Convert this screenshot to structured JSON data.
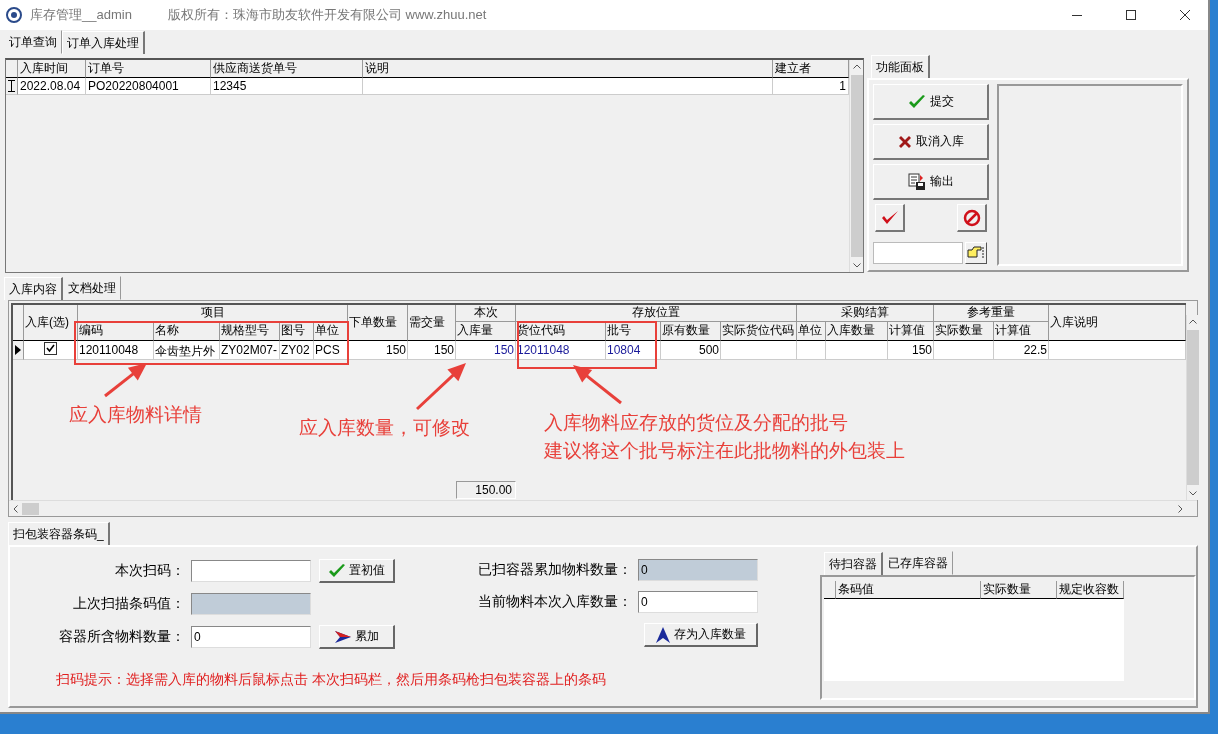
{
  "window": {
    "title": "库存管理__admin",
    "copyright": "版权所有：珠海市助友软件开发有限公司 www.zhuu.net"
  },
  "main_tabs": [
    {
      "label": "订单查询",
      "selected": false
    },
    {
      "label": "订单入库处理",
      "selected": true
    }
  ],
  "order_grid": {
    "columns": [
      "入库时间",
      "订单号",
      "供应商送货单号",
      "说明",
      "建立者"
    ],
    "rows": [
      {
        "editing": true,
        "cells": [
          "2022.08.04",
          "PO20220804001",
          "12345",
          null,
          "1"
        ]
      }
    ]
  },
  "function_panel": {
    "tab": {
      "label": "功能面板",
      "selected": true
    },
    "buttons": [
      {
        "kind": "check",
        "label": "提交"
      },
      {
        "kind": "cross",
        "label": "取消入库"
      },
      {
        "kind": "export",
        "label": "输出"
      }
    ],
    "small_buttons": [
      {
        "kind": "redcheck"
      },
      {
        "kind": "prohibit"
      }
    ],
    "field_button": {
      "kind": "hand"
    }
  },
  "detail_tabs": [
    {
      "label": "入库内容",
      "selected": true
    },
    {
      "label": "文档处理",
      "selected": false
    }
  ],
  "detail_grid": {
    "header": [
      {
        "label": "入库(选)",
        "kind": "check"
      },
      {
        "label": "项目",
        "children": [
          {
            "label": "编码",
            "kind": "text",
            "highlighted": false
          },
          {
            "label": "名称",
            "kind": "text",
            "highlighted": false
          },
          {
            "label": "规格型号",
            "kind": "text",
            "highlighted": false
          },
          {
            "label": "图号",
            "kind": "text",
            "highlighted": false
          },
          {
            "label": "单位",
            "kind": "text",
            "highlighted": false
          }
        ]
      },
      {
        "label": "下单数量",
        "kind": "number",
        "highlighted": false
      },
      {
        "label": "需交量",
        "kind": "number",
        "highlighted": false
      },
      {
        "label": "本次",
        "children": [
          {
            "label": "入库量",
            "kind": "number",
            "highlighted": true,
            "total": "150.00"
          }
        ]
      },
      {
        "label": "存放位置",
        "children": [
          {
            "label": "货位代码",
            "kind": "text",
            "highlighted": true
          },
          {
            "label": "批号",
            "kind": "text",
            "highlighted": true
          },
          {
            "label": "原有数量",
            "kind": "number",
            "highlighted": false
          },
          {
            "label": "实际货位代码",
            "kind": "text"
          }
        ]
      },
      {
        "label": "采购结算",
        "children": [
          {
            "label": "单位",
            "kind": "text"
          },
          {
            "label": "入库数量",
            "kind": "number"
          },
          {
            "label": "计算值",
            "kind": "number",
            "highlighted": false
          }
        ]
      },
      {
        "label": "参考重量",
        "children": [
          {
            "label": "实际数量",
            "kind": "number"
          },
          {
            "label": "计算值",
            "kind": "number",
            "highlighted": false
          }
        ]
      },
      {
        "label": "入库说明",
        "kind": "text"
      }
    ],
    "rows": [
      {
        "current": true,
        "checked": true,
        "cells": [
          "120110048",
          "伞齿垫片外",
          "ZY02M07-",
          "ZY02",
          "PCS",
          "150",
          "150",
          "150",
          "12011048",
          "10804",
          "500",
          null,
          null,
          null,
          "150",
          null,
          "22.5",
          null
        ]
      }
    ]
  },
  "annotations": [
    {
      "lines": [
        "应入库物料详情"
      ]
    },
    {
      "lines": [
        "应入库数量，可修改"
      ]
    },
    {
      "lines": [
        "入库物料应存放的货位及分配的批号",
        "建议将这个批号标注在此批物料的外包装上"
      ]
    }
  ],
  "scan_panel": {
    "tab": {
      "label": "扫包装容器条码_",
      "selected": true
    },
    "left_fields": [
      {
        "label": "本次扫码：",
        "readonly": false,
        "button": {
          "kind": "check",
          "label": "置初值"
        }
      },
      {
        "label": "上次扫描条码值：",
        "readonly": true
      },
      {
        "label": "容器所含物料数量：",
        "value": "0",
        "readonly": false,
        "button": {
          "kind": "arrow",
          "label": "累加"
        }
      }
    ],
    "right_fields": [
      {
        "label": "已扫容器累加物料数量：",
        "value": "0",
        "readonly": true
      },
      {
        "label": "当前物料本次入库数量：",
        "value": "0",
        "readonly": false
      }
    ],
    "save_button": {
      "kind": "up",
      "label": "存为入库数量"
    },
    "hint": "扫码提示：选择需入库的物料后鼠标点击 本次扫码栏，然后用条码枪扫包装容器上的条码",
    "container_tabs": [
      {
        "label": "待扫容器",
        "selected": true
      },
      {
        "label": "已存库容器",
        "selected": false
      }
    ],
    "container_columns": [
      "条码值",
      "实际数量",
      "规定收容数"
    ]
  }
}
